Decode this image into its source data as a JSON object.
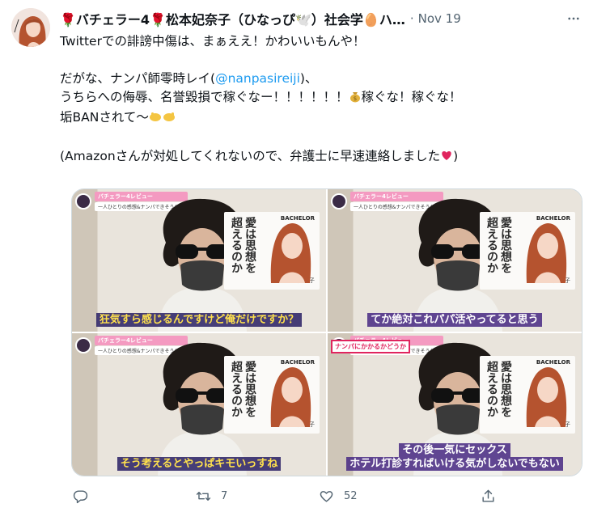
{
  "tweet": {
    "display_name": "🌹バチェラー4🌹松本妃奈子（ひなっぴ🕊️）社会学🥚ハ…",
    "separator": "·",
    "date": "Nov 19",
    "line1": "Twitterでの誹謗中傷は、まぁええ！かわいいもんや！",
    "line2a": "だがな、ナンパ師零時レイ(",
    "mention": "@nanpasireiji",
    "line2b": ")、",
    "line3a": "うちらへの侮辱、名誉毀損で稼ぐなー！！！！！！",
    "line3b": "稼ぐな！稼ぐな！",
    "line4": "垢BANされて〜",
    "line5": "(Amazonさんが対処してくれないので、弁護士に早速連絡しました",
    "line5_end": ")"
  },
  "media": {
    "panel_title": "愛は思想を超えるのか",
    "panel_brand": "BACHELOR",
    "panel_name": "松本 妃奈子",
    "top_tag": "バチェラー4レビュー",
    "top_sub": "一人ひとりの感想&ナンパできそうか？",
    "nanpa_tag": "ナンパにかかるかどうか",
    "subtitles": [
      "狂気すら感じるんですけど俺だけですか？",
      "てか絶対これパパ活やってると思う",
      "そう考えるとやっぱキモいっすね",
      "その後一気にセックス\nホテル打診すればいける気がしないでもない"
    ]
  },
  "actions": {
    "reply_count": "",
    "retweet_count": "7",
    "like_count": "52"
  },
  "icons": {
    "more": "more-icon",
    "reply": "reply-icon",
    "retweet": "retweet-icon",
    "like": "heart-icon",
    "share": "share-icon",
    "money_bag": "money-bag-emoji",
    "hands": "hands-emoji",
    "heart": "red-heart-emoji"
  },
  "colors": {
    "accent": "#1d9bf0",
    "muted": "#536471",
    "text": "#0f1419"
  }
}
